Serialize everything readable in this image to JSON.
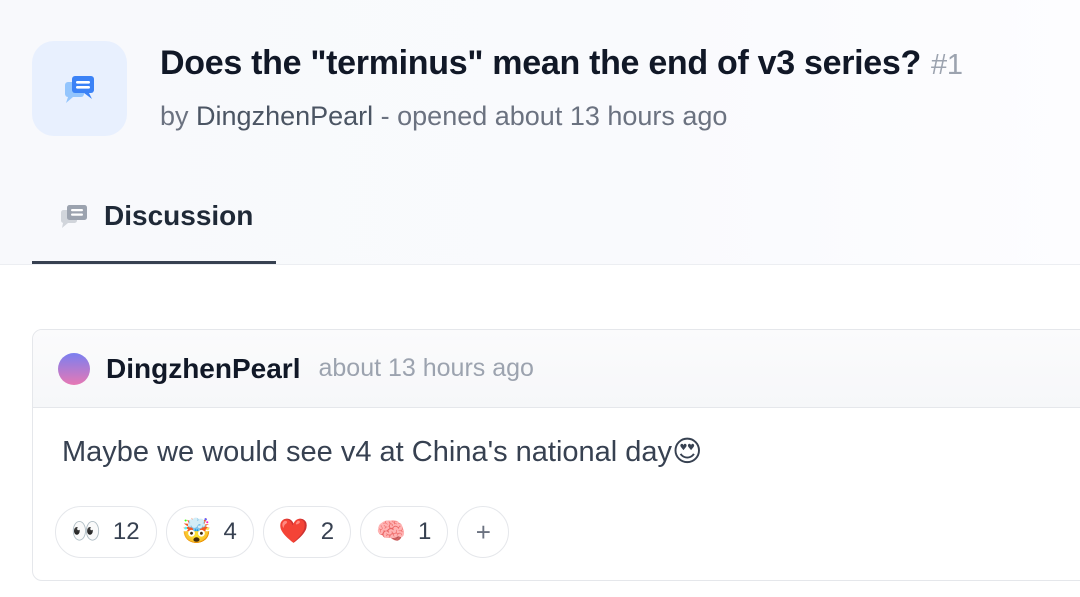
{
  "discussion": {
    "title": "Does the \"terminus\" mean the end of v3 series?",
    "number": "#1",
    "meta_prefix": "by",
    "author": "DingzhenPearl",
    "meta_suffix": " - opened about 13 hours ago"
  },
  "tabs": [
    {
      "label": "Discussion",
      "icon": "discussion-icon",
      "active": true
    }
  ],
  "comment": {
    "author": "DingzhenPearl",
    "time": "about 13 hours ago",
    "text": "Maybe we would see v4 at China's national day",
    "text_emoji": "😍",
    "reactions": [
      {
        "emoji": "👀",
        "name": "eyes-reaction",
        "count": "12"
      },
      {
        "emoji": "🤯",
        "name": "mind-blown-reaction",
        "count": "4"
      },
      {
        "emoji": "❤️",
        "name": "heart-reaction",
        "count": "2"
      },
      {
        "emoji": "🧠",
        "name": "brain-reaction",
        "count": "1"
      }
    ],
    "add_reaction_label": "+"
  },
  "colors": {
    "icon_accent": "#3b82f6",
    "tab_underline": "#374151",
    "avatar_gradient": [
      "#7a7ff0",
      "#e778b4"
    ]
  }
}
